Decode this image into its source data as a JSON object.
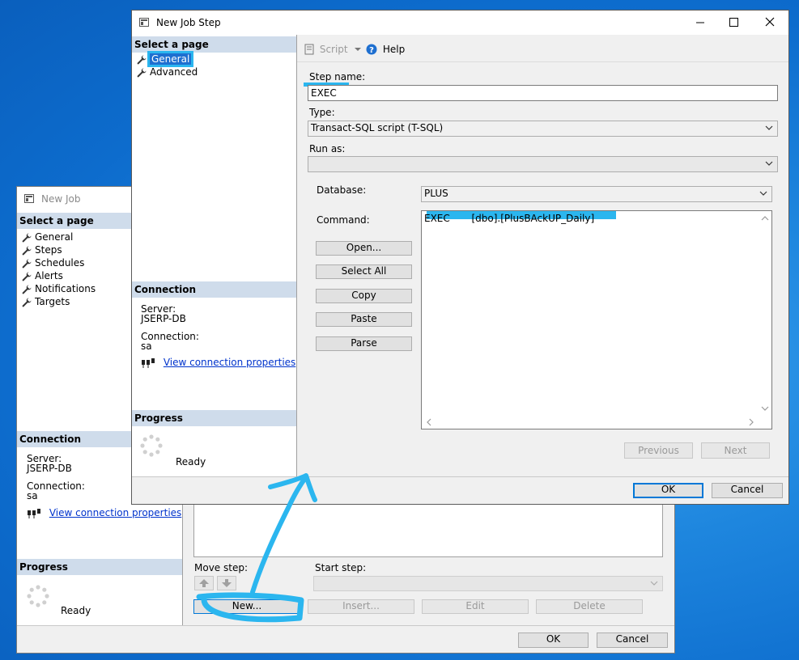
{
  "back_window": {
    "title": "New Job",
    "select_page_header": "Select a page",
    "pages": [
      {
        "label": "General"
      },
      {
        "label": "Steps"
      },
      {
        "label": "Schedules"
      },
      {
        "label": "Alerts"
      },
      {
        "label": "Notifications"
      },
      {
        "label": "Targets"
      }
    ],
    "connection": {
      "header": "Connection",
      "server_label": "Server:",
      "server_value": "JSERP-DB",
      "connection_label": "Connection:",
      "connection_value": "sa",
      "link": "View connection properties"
    },
    "progress": {
      "header": "Progress",
      "status": "Ready"
    },
    "move_step_label": "Move step:",
    "start_step_label": "Start step:",
    "buttons": {
      "new": "New...",
      "insert": "Insert...",
      "edit": "Edit",
      "delete": "Delete",
      "ok": "OK",
      "cancel": "Cancel"
    }
  },
  "front_window": {
    "title": "New Job Step",
    "select_page_header": "Select a page",
    "pages": [
      {
        "label": "General",
        "selected": true
      },
      {
        "label": "Advanced",
        "selected": false
      }
    ],
    "connection": {
      "header": "Connection",
      "server_label": "Server:",
      "server_value": "JSERP-DB",
      "connection_label": "Connection:",
      "connection_value": "sa",
      "link": "View connection properties"
    },
    "progress": {
      "header": "Progress",
      "status": "Ready"
    },
    "toolbar": {
      "script": "Script",
      "help": "Help"
    },
    "step_name_label": "Step name:",
    "step_name_value": "EXEC",
    "type_label": "Type:",
    "type_value": "Transact-SQL script (T-SQL)",
    "run_as_label": "Run as:",
    "run_as_value": "",
    "database_label": "Database:",
    "database_value": "PLUS",
    "command_label": "Command:",
    "command_text": "EXEC       [dbo].[PlusBAckUP_Daily]",
    "side_buttons": {
      "open": "Open...",
      "select_all": "Select All",
      "copy": "Copy",
      "paste": "Paste",
      "parse": "Parse"
    },
    "nav_buttons": {
      "previous": "Previous",
      "next": "Next"
    },
    "buttons": {
      "ok": "OK",
      "cancel": "Cancel"
    }
  },
  "colors": {
    "highlight": "#2bb6ef",
    "section_header": "#cfdceb",
    "link": "#0033cc",
    "default_button_border": "#0078d7"
  }
}
